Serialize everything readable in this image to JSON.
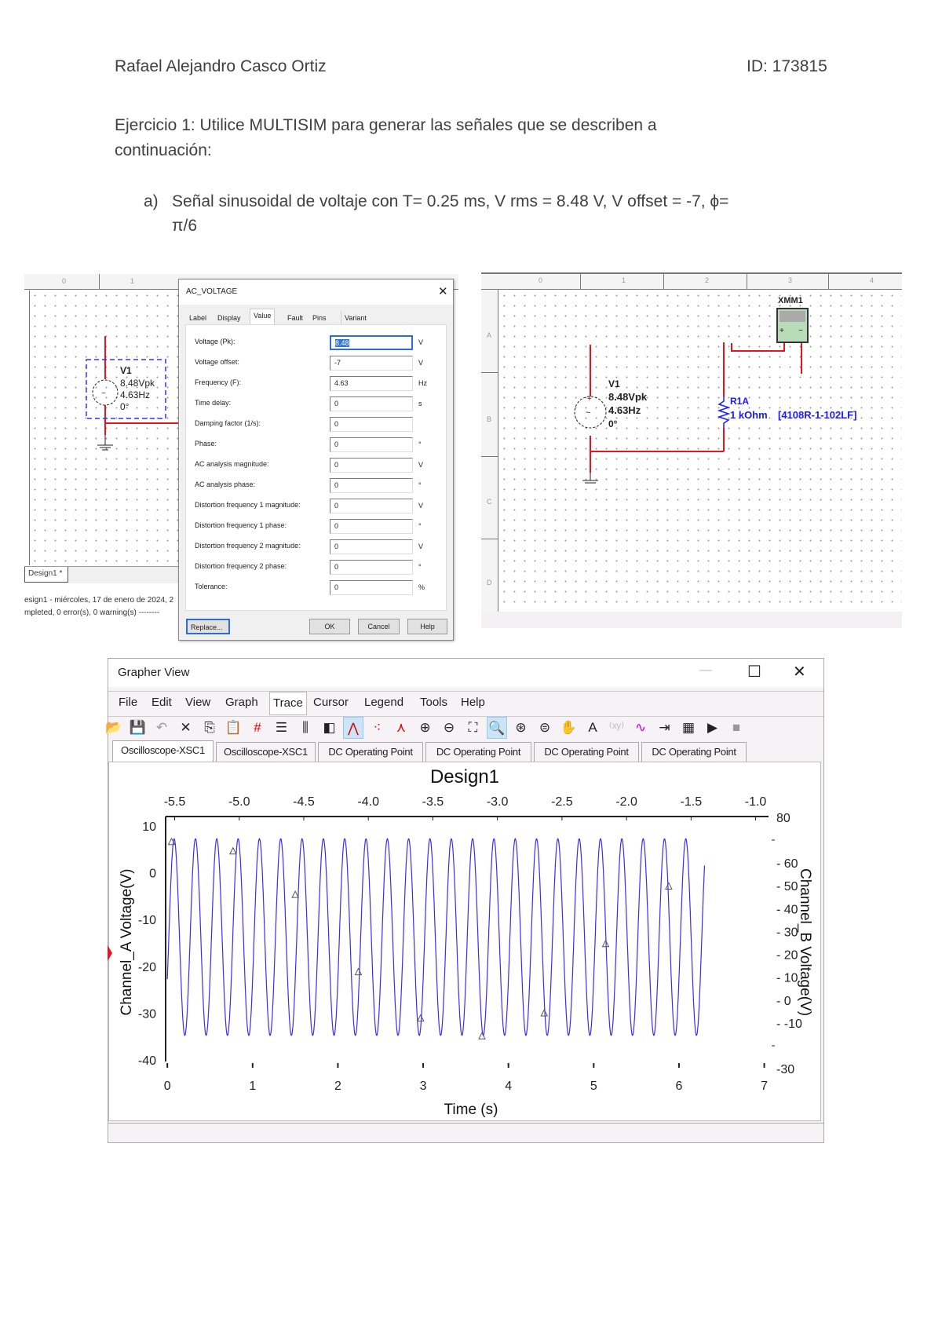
{
  "header": {
    "author": "Rafael Alejandro Casco Ortiz",
    "id": "ID: 173815"
  },
  "exercise": {
    "line1": "Ejercicio 1: Utilice MULTISIM para generar las señales que se describen a",
    "line2": "continuación:",
    "item_marker": "a)",
    "item_line1": "Señal sinusoidal de voltaje con T= 0.25 ms, V rms = 8.48 V, V offset = -7, ϕ=",
    "item_line2": "π/6"
  },
  "left_schematic": {
    "ruler_cols": [
      "0",
      "1"
    ],
    "source": {
      "name": "V1",
      "amplitude": "8.48Vpk",
      "frequency": "4.63Hz",
      "phase": "0°"
    },
    "design_tab": "Design1 *",
    "status_line1": "esign1 - miércoles, 17 de enero de 2024, 2",
    "status_line2": "mpleted, 0 error(s), 0 warning(s) --------"
  },
  "dialog": {
    "title": "AC_VOLTAGE",
    "tabs": [
      "Label",
      "Display",
      "Value",
      "Fault",
      "Pins",
      "Variant"
    ],
    "active_tab": "Value",
    "fields": [
      {
        "label": "Voltage (Pk):",
        "value": "8.48",
        "unit": "V"
      },
      {
        "label": "Voltage offset:",
        "value": "-7",
        "unit": "V"
      },
      {
        "label": "Frequency (F):",
        "value": "4.63",
        "unit": "Hz"
      },
      {
        "label": "Time delay:",
        "value": "0",
        "unit": "s"
      },
      {
        "label": "Damping factor (1/s):",
        "value": "0",
        "unit": ""
      },
      {
        "label": "Phase:",
        "value": "0",
        "unit": "°"
      },
      {
        "label": "AC analysis magnitude:",
        "value": "0",
        "unit": "V"
      },
      {
        "label": "AC analysis phase:",
        "value": "0",
        "unit": "°"
      },
      {
        "label": "Distortion frequency 1 magnitude:",
        "value": "0",
        "unit": "V"
      },
      {
        "label": "Distortion frequency 1 phase:",
        "value": "0",
        "unit": "°"
      },
      {
        "label": "Distortion frequency 2 magnitude:",
        "value": "0",
        "unit": "V"
      },
      {
        "label": "Distortion frequency 2 phase:",
        "value": "0",
        "unit": "°"
      },
      {
        "label": "Tolerance:",
        "value": "0",
        "unit": "%"
      }
    ],
    "buttons": {
      "replace": "Replace...",
      "ok": "OK",
      "cancel": "Cancel",
      "help": "Help"
    }
  },
  "right_schematic": {
    "ruler_cols": [
      "0",
      "1",
      "2",
      "3",
      "4"
    ],
    "ruler_rows": [
      "A",
      "B",
      "C",
      "D"
    ],
    "source": {
      "name": "V1",
      "amplitude": "8.48Vpk",
      "frequency": "4.63Hz",
      "phase": "0°"
    },
    "resistor": {
      "name": "R1A",
      "value": "1 kOhm",
      "part": "[4108R-1-102LF]"
    },
    "meter": {
      "name": "XMM1"
    },
    "wire_color": "#e8141b",
    "component_color": "#1a1aff"
  },
  "grapher": {
    "title": "Grapher View",
    "menu": [
      "File",
      "Edit",
      "View",
      "Graph",
      "Trace",
      "Cursor",
      "Legend",
      "Tools",
      "Help"
    ],
    "active_menu": "Trace",
    "toolbar": [
      "open-icon",
      "save-icon",
      "undo-icon",
      "delete-icon",
      "copy-icon",
      "paste-icon",
      "grid-icon",
      "legend-icon",
      "cursors-icon",
      "overlay-icon",
      "line-trace-icon",
      "dots-trace-icon",
      "line-dots-icon",
      "zoom-in-icon",
      "zoom-out-icon",
      "zoom-fit-icon",
      "zoom-select-icon",
      "zoom-x-icon",
      "zoom-y-icon",
      "pan-icon",
      "text-icon",
      "coordinates-icon",
      "invert-icon",
      "export-icon",
      "copy-page-icon",
      "print-icon",
      "stop-icon"
    ],
    "tabs": [
      "Oscilloscope-XSC1",
      "Oscilloscope-XSC1",
      "DC Operating Point",
      "DC Operating Point",
      "DC Operating Point",
      "DC Operating Point"
    ]
  },
  "chart_data": {
    "type": "line",
    "title": "Design1",
    "xlabel": "Time (s)",
    "ylabel": "Channel_A Voltage(V)",
    "y2label": "Channel_B Voltage(V)",
    "xlim": [
      -0.02,
      7.05
    ],
    "xticks": [
      0,
      1,
      2,
      3,
      4,
      5,
      6,
      7
    ],
    "x2lim": [
      -5.57,
      -0.9
    ],
    "x2ticks": [
      -5.5,
      -5.0,
      -4.5,
      -4.0,
      -3.5,
      -3.0,
      -2.5,
      -2.0,
      -1.5,
      -1.0
    ],
    "ylim": [
      -42,
      12
    ],
    "yticks": [
      10,
      0,
      -10,
      -20,
      -30,
      -40
    ],
    "y2lim": [
      -30.3,
      80.3
    ],
    "y2ticks": [
      80,
      60,
      50,
      40,
      30,
      20,
      10,
      0,
      -10,
      -30
    ],
    "y2minor": [
      70,
      -20
    ],
    "grid": false,
    "series": [
      {
        "color": "#3b2cf5",
        "waveform": "sine",
        "amplitude": 21,
        "offset": -13.75,
        "frequency_hz": 4,
        "peak_time": 0.08,
        "t_range": [
          0,
          6.3
        ]
      }
    ],
    "markers": [
      {
        "x": 0.05,
        "y": 6.5
      },
      {
        "x": 0.77,
        "y": 4.5
      },
      {
        "x": 1.5,
        "y": -4.8
      },
      {
        "x": 2.24,
        "y": -21.3
      },
      {
        "x": 2.97,
        "y": -31.2
      },
      {
        "x": 3.69,
        "y": -35
      },
      {
        "x": 4.42,
        "y": -30.1
      },
      {
        "x": 5.14,
        "y": -15.3
      },
      {
        "x": 5.88,
        "y": -3
      }
    ]
  }
}
